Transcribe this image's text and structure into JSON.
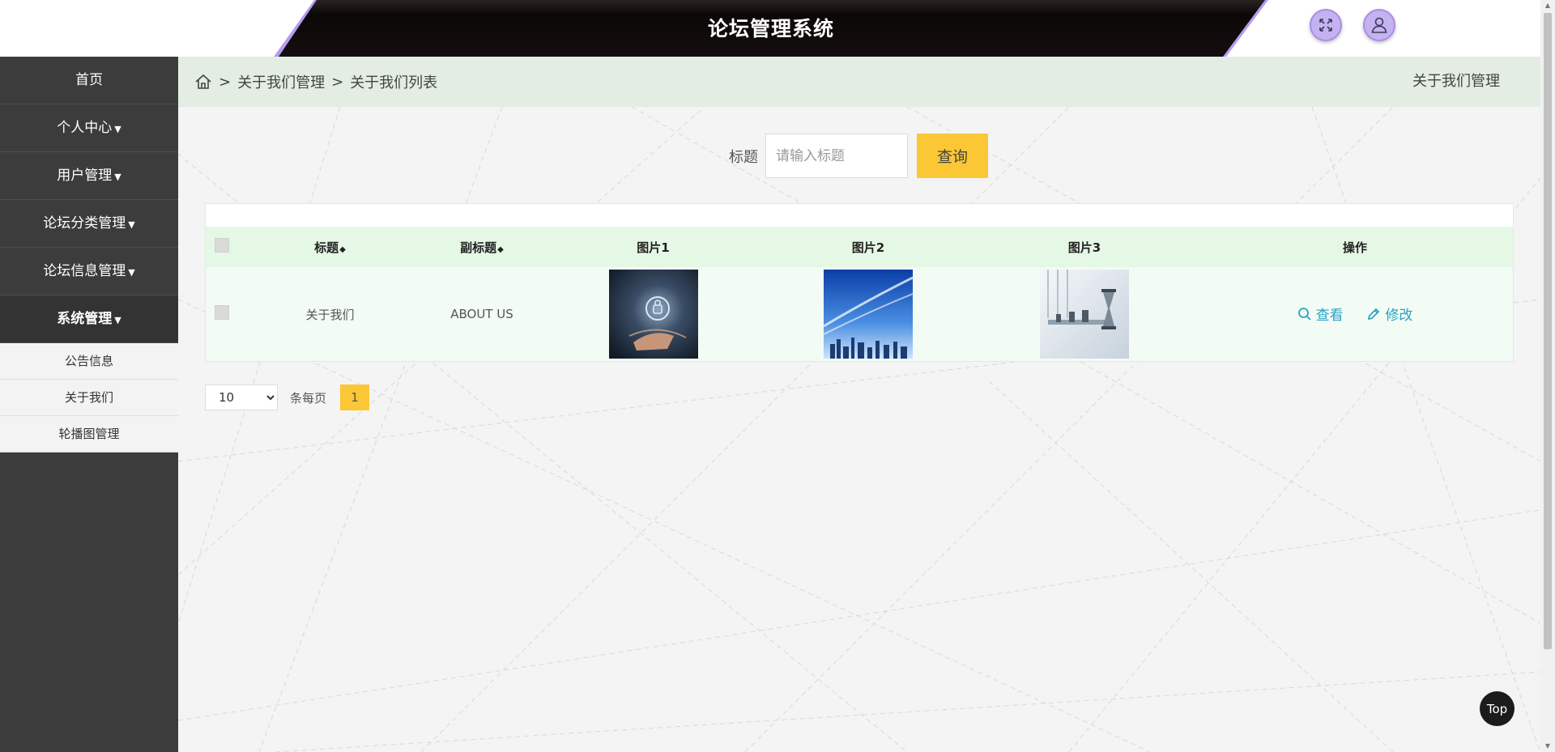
{
  "header": {
    "title": "论坛管理系统",
    "fullscreen_icon": "expand-icon",
    "user_icon": "user-icon",
    "accent_color": "#b69bf0"
  },
  "sidebar": {
    "items": [
      {
        "label": "首页",
        "has_caret": false
      },
      {
        "label": "个人中心",
        "has_caret": true
      },
      {
        "label": "用户管理",
        "has_caret": true
      },
      {
        "label": "论坛分类管理",
        "has_caret": true
      },
      {
        "label": "论坛信息管理",
        "has_caret": true
      },
      {
        "label": "系统管理",
        "has_caret": true,
        "active": true
      }
    ],
    "sub_items": [
      "公告信息",
      "关于我们",
      "轮播图管理"
    ]
  },
  "breadcrumb": {
    "home_icon": "home-icon",
    "sep": ">",
    "level1": "关于我们管理",
    "level2": "关于我们列表",
    "right_title": "关于我们管理"
  },
  "search": {
    "label": "标题",
    "placeholder": "请输入标题",
    "button": "查询"
  },
  "table": {
    "headers": [
      "标题",
      "副标题",
      "图片1",
      "图片2",
      "图片3",
      "操作"
    ],
    "rows": [
      {
        "title": "关于我们",
        "subtitle": "ABOUT US"
      }
    ],
    "view_label": "查看",
    "edit_label": "修改"
  },
  "pager": {
    "page_size": "10",
    "page_size_options": [
      "10"
    ],
    "per_page_label": "条每页",
    "current_page": "1"
  },
  "top_button": "Top",
  "colors": {
    "sidebar_bg": "#3c3c3c",
    "accent_yellow": "#fcc735",
    "link_blue": "#2aa3c4",
    "header_green": "#e5f8e5"
  }
}
